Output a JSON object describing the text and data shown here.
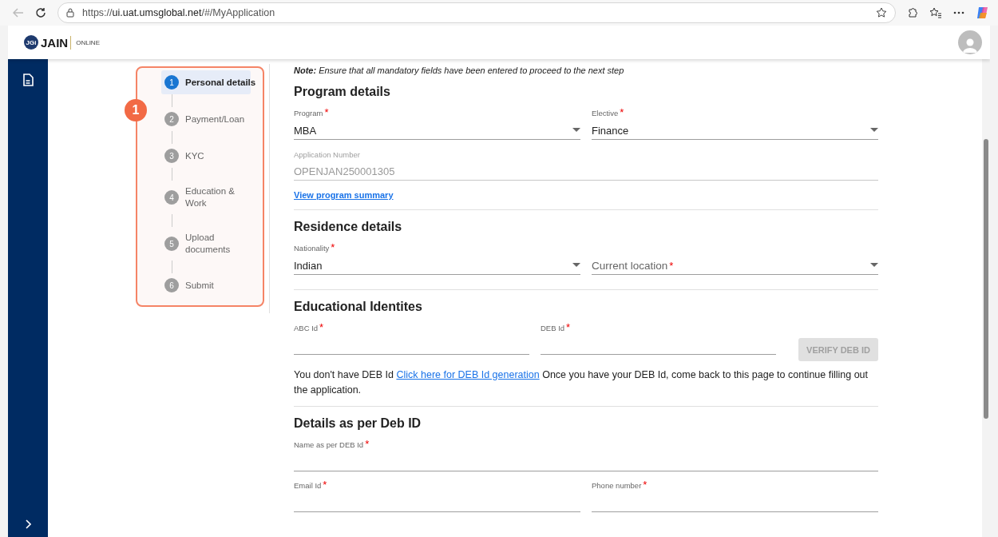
{
  "browser": {
    "url_parts": [
      "https://",
      "ui.uat.umsglobal.net",
      "/#/MyApplication"
    ]
  },
  "header": {
    "logo_mark": "JGi",
    "logo_text": "JAIN",
    "logo_sub": "ONLINE"
  },
  "stepper": {
    "callout": "1",
    "steps": [
      {
        "number": "1",
        "label": "Personal details",
        "selected": true
      },
      {
        "number": "2",
        "label": "Payment/Loan",
        "selected": false
      },
      {
        "number": "3",
        "label": "KYC",
        "selected": false
      },
      {
        "number": "4",
        "label": "Education & Work",
        "selected": false
      },
      {
        "number": "5",
        "label": "Upload documents",
        "selected": false
      },
      {
        "number": "6",
        "label": "Submit",
        "selected": false
      }
    ]
  },
  "note": "**Note:** Ensure that all mandatory fields have been entered to proceed to the next step",
  "sections": [
    {
      "title": "Program details",
      "rows": [
        {
          "fields": [
            {
              "kind": "select",
              "label": "Program",
              "mark": "*",
              "value": "MBA",
              "disabled": false
            },
            {
              "kind": "select",
              "label": "Elective",
              "mark": "*",
              "value": "Finance",
              "disabled": false
            }
          ]
        },
        {
          "fields": [
            {
              "kind": "text",
              "label": "Application Number",
              "value": "OPENJAN250001305",
              "disabled": true
            }
          ]
        }
      ],
      "link": "View program summary"
    },
    {
      "title": "Residence details",
      "rows": [
        {
          "fields": [
            {
              "kind": "select",
              "label": "Nationality",
              "mark": "*",
              "value": "Indian",
              "disabled": false
            },
            {
              "kind": "select",
              "placeholder": "Current location",
              "mark": "*",
              "disabled": false
            }
          ]
        }
      ]
    },
    {
      "title": "Educational Identites",
      "rows": [
        {
          "fields": [
            {
              "kind": "text",
              "label": "ABC Id",
              "mark": "*",
              "disabled": false
            },
            {
              "kind": "text",
              "label": "DEB Id",
              "mark": "*",
              "disabled": false
            },
            {
              "kind": "button",
              "label": "VERIFY DEB ID",
              "disabled": true
            }
          ]
        }
      ],
      "message": {
        "before": "You don't have DEB Id",
        "link": "Click here for DEB Id generation",
        "after": "Once you have your DEB Id, come back to this page to continue filling out the application."
      }
    },
    {
      "title": "Details as per Deb ID",
      "rows": [
        {
          "fields": [
            {
              "kind": "text",
              "label": "Name as per DEB Id",
              "mark": "*",
              "disabled": false
            }
          ]
        },
        {
          "fields": [
            {
              "kind": "text",
              "label": "Email Id",
              "mark": "*",
              "disabled": false
            },
            {
              "kind": "text",
              "label": "Phone number",
              "mark": "*",
              "disabled": false
            }
          ]
        }
      ]
    }
  ]
}
